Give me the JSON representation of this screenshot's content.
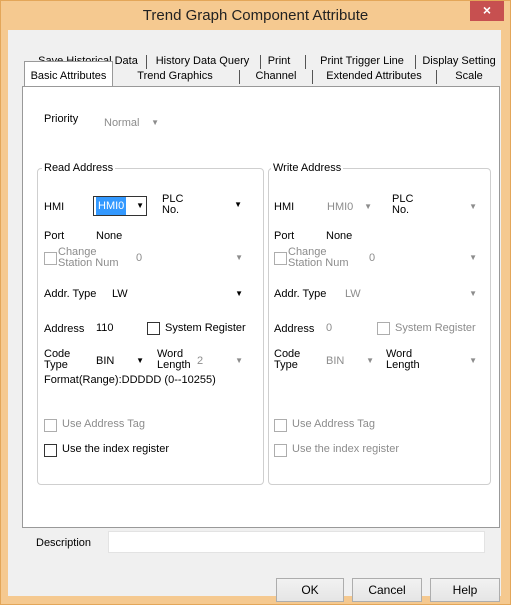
{
  "window": {
    "title": "Trend Graph Component Attribute",
    "close_glyph": "×"
  },
  "tabs_back": [
    "Save Historical Data",
    "History Data Query",
    "Print",
    "Print Trigger Line",
    "Display Setting"
  ],
  "tabs_front": [
    "Basic Attributes",
    "Trend Graphics",
    "Channel",
    "Extended Attributes",
    "Scale"
  ],
  "priority": {
    "label": "Priority",
    "value": "Normal"
  },
  "read": {
    "title": "Read Address",
    "hmi_label": "HMI",
    "hmi_value": "HMI0",
    "plc_label": "PLC\nNo.",
    "port_label": "Port",
    "port_value": "None",
    "change_station": "Change\nStation Num",
    "station_value": "0",
    "addr_type_label": "Addr. Type",
    "addr_type_value": "LW",
    "address_label": "Address",
    "address_value": "110",
    "system_register": "System Register",
    "code_type_label": "Code\nType",
    "code_type_value": "BIN",
    "word_length_label": "Word\nLength",
    "word_length_value": "2",
    "format": "Format(Range):DDDDD (0--10255)",
    "use_tag": "Use Address Tag",
    "use_index": "Use the index register"
  },
  "write": {
    "title": "Write Address",
    "hmi_label": "HMI",
    "hmi_value": "HMI0",
    "plc_label": "PLC\nNo.",
    "port_label": "Port",
    "port_value": "None",
    "change_station": "Change\nStation Num",
    "station_value": "0",
    "addr_type_label": "Addr. Type",
    "addr_type_value": "LW",
    "address_label": "Address",
    "address_value": "0",
    "system_register": "System Register",
    "code_type_label": "Code\nType",
    "code_type_value": "BIN",
    "word_length_label": "Word\nLength",
    "use_tag": "Use Address Tag",
    "use_index": "Use the index register"
  },
  "description": {
    "label": "Description",
    "value": ""
  },
  "buttons": {
    "ok": "OK",
    "cancel": "Cancel",
    "help": "Help"
  }
}
